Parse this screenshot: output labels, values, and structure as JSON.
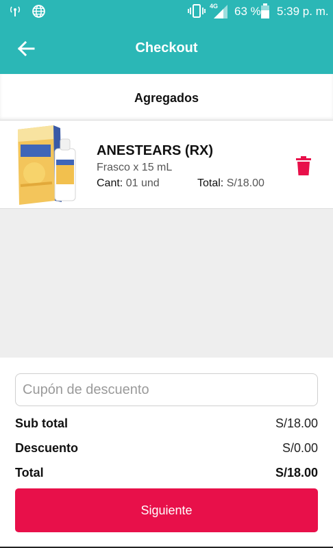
{
  "status_bar": {
    "network": "4G",
    "battery": "63 %",
    "time": "5:39 p. m.",
    "icons": [
      "hotspot-icon",
      "globe-icon",
      "vibrate-icon",
      "signal-icon",
      "battery-icon"
    ]
  },
  "app_bar": {
    "title": "Checkout",
    "back_icon": "arrow-left-icon",
    "color": "#2bb7b6"
  },
  "section": {
    "title": "Agregados"
  },
  "cart": {
    "items": [
      {
        "name": "ANESTEARS (RX)",
        "description": "Frasco x 15 mL",
        "qty_label": "Cant:",
        "qty_value": "01 und",
        "total_label": "Total:",
        "total_value": "S/18.00",
        "delete_icon": "trash-icon"
      }
    ]
  },
  "coupon": {
    "placeholder": "Cupón de descuento",
    "value": ""
  },
  "summary": {
    "subtotal_label": "Sub total",
    "subtotal_value": "S/18.00",
    "discount_label": "Descuento",
    "discount_value": "S/0.00",
    "total_label": "Total",
    "total_value": "S/18.00"
  },
  "actions": {
    "next_label": "Siguiente",
    "accent_color": "#e8104a"
  }
}
